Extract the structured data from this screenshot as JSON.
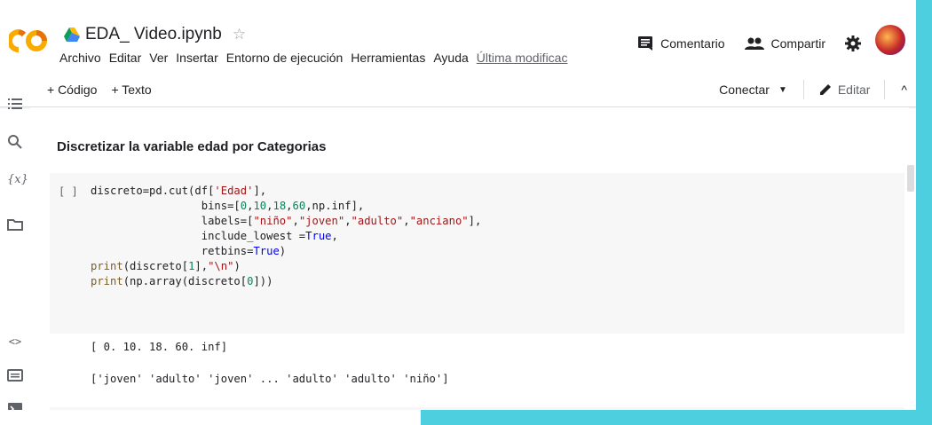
{
  "notebook": {
    "title": "EDA_ Video.ipynb",
    "star_icon": "star-outline-icon"
  },
  "menu": [
    "Archivo",
    "Editar",
    "Ver",
    "Insertar",
    "Entorno de ejecución",
    "Herramientas",
    "Ayuda"
  ],
  "menu_last": "Última modificac",
  "header_actions": {
    "comment_label": "Comentario",
    "share_label": "Compartir"
  },
  "toolbar": {
    "add_code": "+ Código",
    "add_text": "+ Texto",
    "connect_label": "Conectar",
    "edit_label": "Editar"
  },
  "sidebar_icons": [
    "toc-icon",
    "search-icon",
    "variables-icon",
    "folder-icon",
    "code-snippets-icon",
    "command-palette-icon",
    "terminal-icon"
  ],
  "section_heading": "Discretizar la variable edad por Categorias",
  "cell": {
    "run_indicator": "[ ]",
    "code_lines": [
      "discreto=pd.cut(df['Edad'],",
      "                 bins=[0,10,18,60,np.inf],",
      "                 labels=[\"niño\",\"joven\",\"adulto\",\"anciano\"],",
      "                 include_lowest =True,",
      "                 retbins=True)",
      "print(discreto[1],\"\\n\")",
      "print(np.array(discreto[0]))"
    ]
  },
  "output": {
    "line1": "[ 0. 10. 18. 60. inf]",
    "line2": "['joven' 'adulto' 'joven' ... 'adulto' 'adulto' 'niño']"
  },
  "colors": {
    "background_band": "#4dcfe0",
    "colab_orange": "#f9ab00",
    "string": "#a31515",
    "number": "#098658",
    "keyword": "#0000ff"
  }
}
